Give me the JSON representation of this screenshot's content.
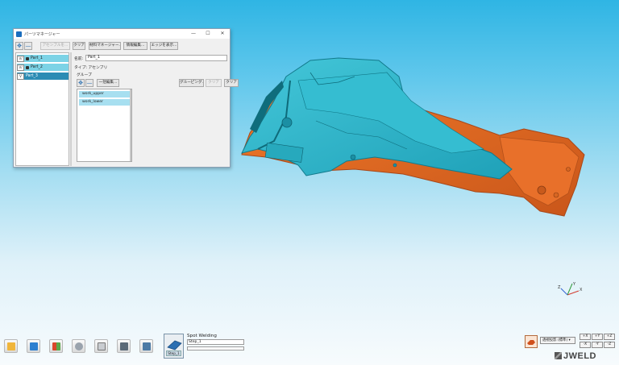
{
  "part_manager": {
    "title": "パーツマネージャー",
    "controls": {
      "minimize": "—",
      "maximize": "☐",
      "close": "✕"
    },
    "toolbar": {
      "add_icon": "move-icon",
      "remove_icon": "minus-icon",
      "btn_disabled": "アセンブルを...",
      "btn_clear": "クリア",
      "btn_material": "材料マネージャー...",
      "btn_info": "情報編集...",
      "btn_edge": "エッジを表示..."
    },
    "tree": {
      "items": [
        {
          "vis": "V/",
          "label": "Part_1",
          "state": "selected"
        },
        {
          "vis": "V/",
          "label": "Part_2",
          "state": "selected"
        },
        {
          "vis": "V",
          "label": "Part_3",
          "state": "active"
        }
      ]
    },
    "properties": {
      "name_label": "名前:",
      "name_value": "Part_1",
      "type_label": "タイプ: アセンブリ",
      "group_label": "グループ",
      "btn_batch_edit": "一括編集...",
      "btn_grouping": "グルーピング...",
      "btn_disabled": "クリア",
      "btn_clear": "クリア",
      "groups": [
        "work_upper",
        "work_lower"
      ]
    }
  },
  "bottom_toolbar": {
    "tools": [
      "folder-icon",
      "cube-icon",
      "material-icon",
      "gear-icon",
      "report-icon",
      "image-icon",
      "screen-icon"
    ],
    "step": {
      "caption": "Step_1",
      "title": "Spot Welding",
      "input_value": "Step_1"
    }
  },
  "view_controls": {
    "view_select": "透視投影 (標準) ▾",
    "axis_buttons": [
      "+X",
      "+Y",
      "+Z",
      "-X",
      "-Y",
      "-Z"
    ],
    "triad_labels": [
      "X",
      "Y",
      "Z"
    ]
  },
  "brand": "JWELD",
  "colors": {
    "background_top": "#2fb5e4",
    "background_bottom": "#f7fbfd",
    "part_teal": "#2bb7c9",
    "part_orange": "#e56b1f",
    "selection": "#7cd3e6"
  }
}
